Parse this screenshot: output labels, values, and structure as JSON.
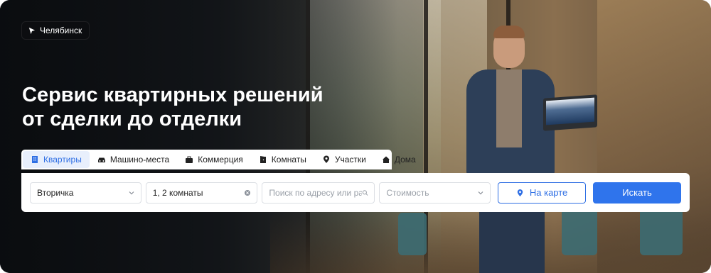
{
  "city": {
    "label": "Челябинск",
    "icon": "cursor-arrow-icon"
  },
  "hero": {
    "title_line1": "Сервис квартирных решений",
    "title_line2": "от сделки до отделки"
  },
  "tabs": [
    {
      "label": "Квартиры",
      "icon": "building-icon",
      "active": true
    },
    {
      "label": "Машино-места",
      "icon": "car-icon",
      "active": false
    },
    {
      "label": "Коммерция",
      "icon": "briefcase-icon",
      "active": false
    },
    {
      "label": "Комнаты",
      "icon": "door-icon",
      "active": false
    },
    {
      "label": "Участки",
      "icon": "map-pin-icon",
      "active": false
    },
    {
      "label": "Дома",
      "icon": "house-icon",
      "active": false
    }
  ],
  "search": {
    "type_value": "Вторичка",
    "rooms_value": "1, 2 комнаты",
    "address_placeholder": "Поиск по адресу или ра...",
    "price_placeholder": "Стоимость",
    "map_button": "На карте",
    "search_button": "Искать"
  },
  "colors": {
    "accent": "#2f74ec",
    "active_tab_bg": "#e8effc",
    "chip_bg": "#0c0d10"
  }
}
